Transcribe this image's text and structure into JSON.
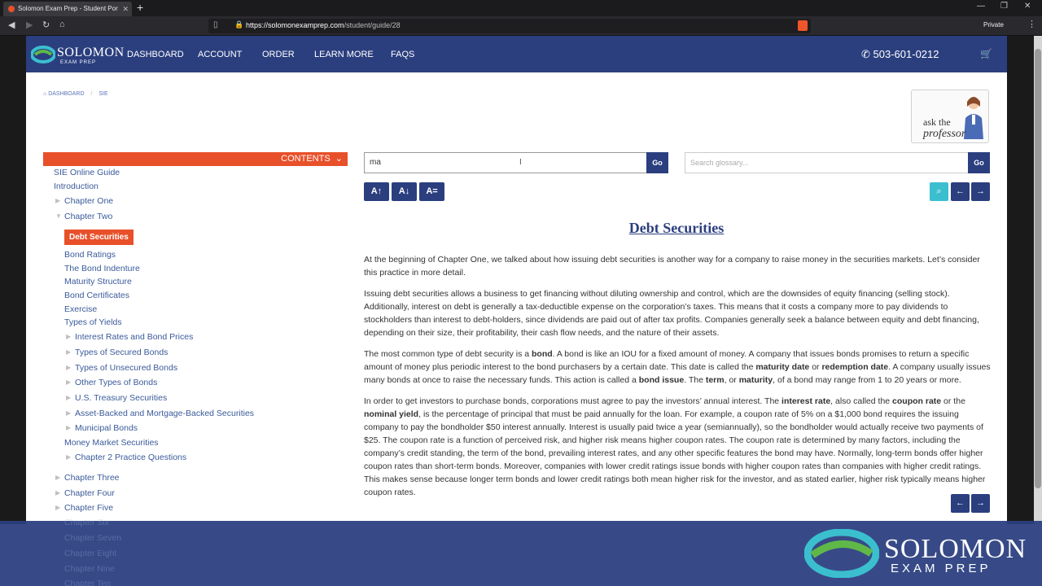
{
  "browser": {
    "tab_title": "Solomon Exam Prep - Student Por",
    "url_domain": "https://solomonexamprep.com",
    "url_path": "/student/guide/28",
    "private_label": "Private"
  },
  "nav": {
    "logo_text": "SOLOMON",
    "logo_sub": "EXAM PREP",
    "items": [
      "DASHBOARD",
      "ACCOUNT",
      "ORDER",
      "LEARN MORE",
      "FAQS"
    ],
    "phone": "503-601-0212"
  },
  "breadcrumb": [
    "DASHBOARD",
    "SIE"
  ],
  "professor": {
    "ask": "ask the",
    "name": "professor"
  },
  "contents_label": "CONTENTS",
  "toc": {
    "top": [
      "SIE Online Guide",
      "Introduction"
    ],
    "chapter_one": "Chapter One",
    "chapter_two": "Chapter Two",
    "active": "Debt Securities",
    "sub": [
      "Bond Ratings",
      "The Bond Indenture",
      "Maturity Structure",
      "Bond Certificates",
      "Exercise",
      "Types of Yields"
    ],
    "nested": [
      "Interest Rates and Bond Prices",
      "Types of Secured Bonds",
      "Types of Unsecured Bonds",
      "Other Types of Bonds",
      "U.S. Treasury Securities",
      "Asset-Backed and Mortgage-Backed Securities",
      "Municipal Bonds"
    ],
    "money_market": "Money Market Securities",
    "practice": "Chapter 2 Practice Questions",
    "later": [
      "Chapter Three",
      "Chapter Four",
      "Chapter Five",
      "Chapter Six",
      "Chapter Seven",
      "Chapter Eight",
      "Chapter Nine",
      "Chapter Ten"
    ]
  },
  "search": {
    "value": "ma",
    "go": "Go"
  },
  "glossary": {
    "placeholder": "Search glossary...",
    "go": "Go"
  },
  "font_buttons": [
    "A↑",
    "A↓",
    "A="
  ],
  "article": {
    "title": "Debt Securities",
    "p1": "At the beginning of Chapter One, we talked about how issuing debt securities is another way for a company to raise money in the securities markets. Let’s consider this practice in more detail.",
    "p2": "Issuing debt securities allows a business to get financing without diluting ownership and control, which are the downsides of equity financing (selling stock). Additionally, interest on debt is generally a tax-deductible expense on the corporation’s taxes. This means that it costs a company more to pay dividends to stockholders than interest to debt-holders, since dividends are paid out of after tax profits. Companies generally seek a balance between equity and debt financing, depending on their size, their profitability, their cash flow needs, and the nature of their assets.",
    "p3": [
      "The most common type of debt security is a ",
      "bond",
      ". A bond is like an IOU for a fixed amount of money. A company that issues bonds promises to return a specific amount of money plus periodic interest to the bond purchasers by a certain date. This date is called the ",
      "maturity date",
      " or ",
      "redemption date",
      ". A company usually issues many bonds at once to raise the necessary funds. This action is called a ",
      "bond issue",
      ". The ",
      "term",
      ", or ",
      "maturity",
      ", of a bond may range from 1 to 20 years or more."
    ],
    "p4": [
      "In order to get investors to purchase bonds, corporations must agree to pay the investors’ annual interest. The ",
      "interest rate",
      ", also called the ",
      "coupon rate",
      " or the ",
      "nominal yield",
      ", is the percentage of principal that must be paid annually for the loan. For example, a coupon rate of 5% on a $1,000 bond requires the issuing company to pay the bondholder $50 interest annually. Interest is usually paid twice a year (semiannually), so the bondholder would actually receive two payments of $25. The coupon rate is a function of perceived risk, and higher risk means higher coupon rates. The coupon rate is determined by many factors, including the company’s credit standing, the term of the bond, prevailing interest rates, and any other specific features the bond may have. Normally, long-term bonds offer higher coupon rates than short-term bonds. Moreover, companies with lower credit ratings issue bonds with higher coupon rates than companies with higher credit ratings. This makes sense because longer term bonds and lower credit ratings both mean higher risk for the investor, and as stated earlier, higher risk typically means higher coupon rates."
    ]
  },
  "banner": {
    "logo_text": "SOLOMON",
    "logo_sub": "EXAM PREP"
  },
  "colors": {
    "navy": "#2b3f7f",
    "orange": "#e8502a",
    "teal": "#3bbfcf"
  }
}
